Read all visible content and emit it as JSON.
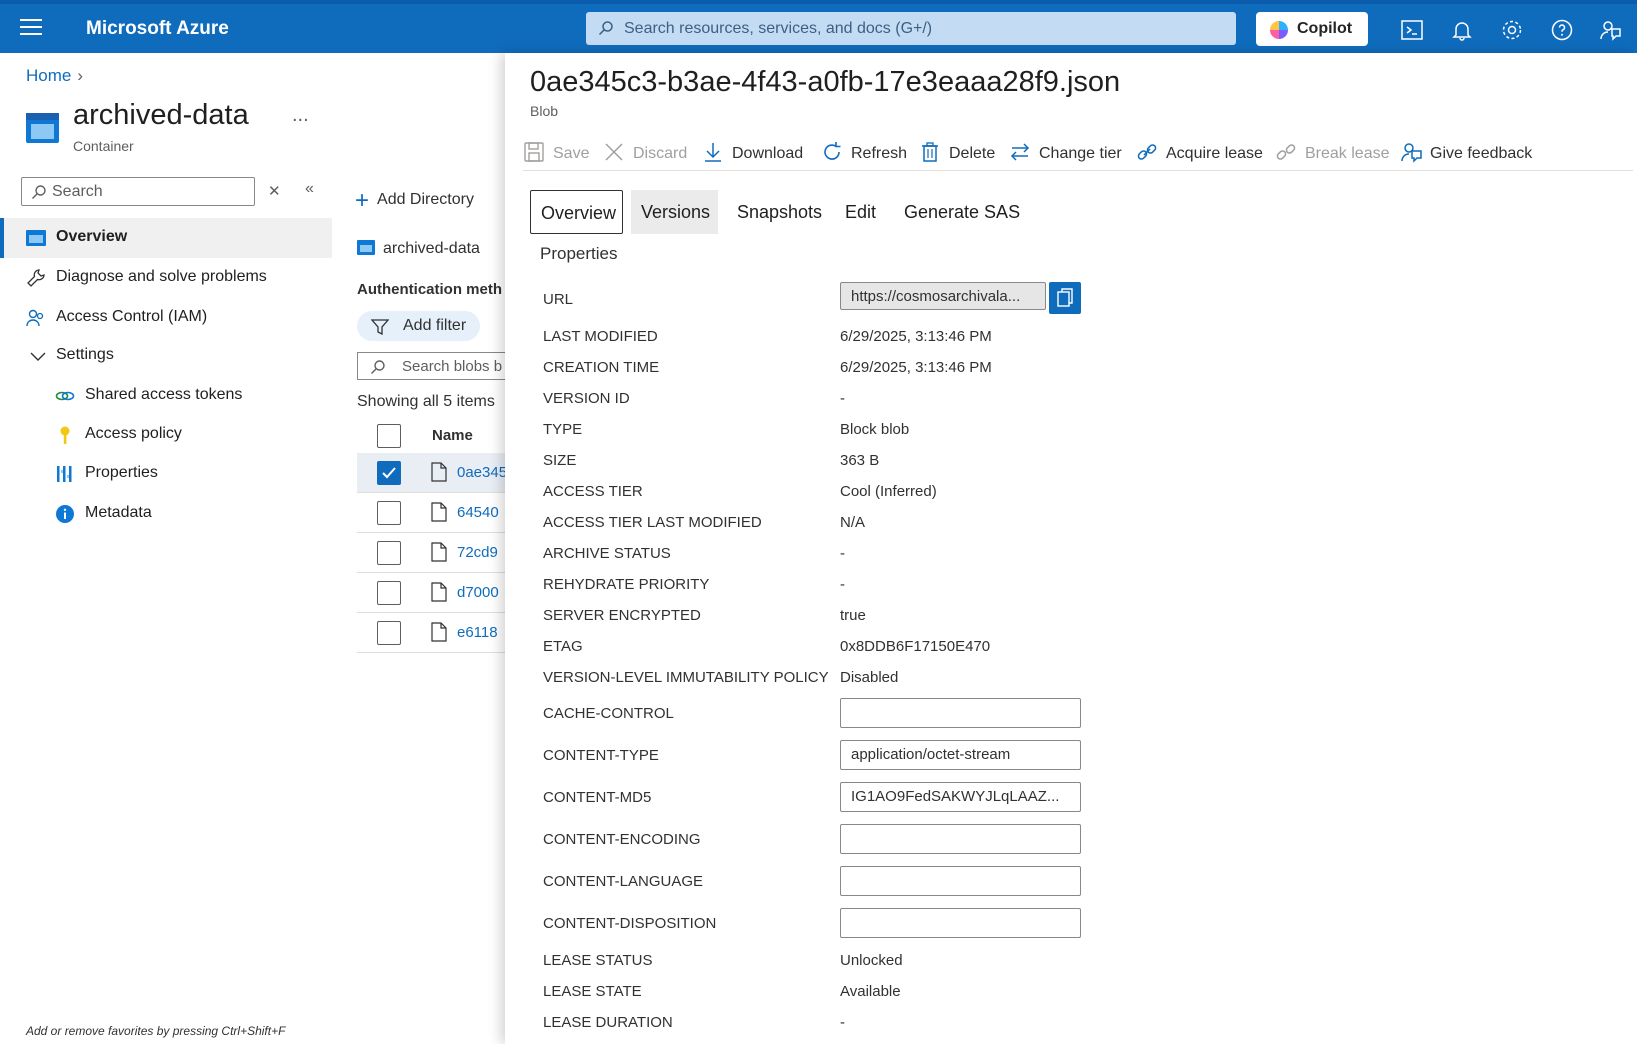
{
  "topbar": {
    "brand": "Microsoft Azure",
    "search_placeholder": "Search resources, services, and docs (G+/)",
    "copilot_label": "Copilot",
    "accent": "#0f6cbd"
  },
  "breadcrumb": {
    "home": "Home"
  },
  "resource": {
    "title": "archived-data",
    "subtitle": "Container",
    "more": "..."
  },
  "leftnav": {
    "search_placeholder": "Search",
    "items": [
      {
        "label": "Overview",
        "icon": "container-icon"
      },
      {
        "label": "Diagnose and solve problems",
        "icon": "wrench-icon"
      },
      {
        "label": "Access Control (IAM)",
        "icon": "people-icon"
      },
      {
        "label": "Settings",
        "icon": "chevron-down-icon"
      },
      {
        "label": "Shared access tokens",
        "icon": "link-icon"
      },
      {
        "label": "Access policy",
        "icon": "key-icon"
      },
      {
        "label": "Properties",
        "icon": "bars-icon"
      },
      {
        "label": "Metadata",
        "icon": "info-icon"
      }
    ],
    "footer_hint": "Add or remove favorites by pressing Ctrl+Shift+F"
  },
  "list": {
    "add_directory": "Add Directory",
    "path": "archived-data",
    "auth_method": "Authentication meth",
    "add_filter": "Add filter",
    "search_placeholder": "Search blobs b",
    "showing": "Showing all 5 items",
    "col_name": "Name",
    "rows": [
      {
        "name": "0ae345",
        "selected": true
      },
      {
        "name": "64540",
        "selected": false
      },
      {
        "name": "72cd9",
        "selected": false
      },
      {
        "name": "d7000",
        "selected": false
      },
      {
        "name": "e6118",
        "selected": false
      }
    ]
  },
  "panel": {
    "title": "0ae345c3-b3ae-4f43-a0fb-17e3eaaa28f9.json",
    "subtitle": "Blob",
    "commands": [
      {
        "label": "Save",
        "icon": "save-icon",
        "disabled": true
      },
      {
        "label": "Discard",
        "icon": "close-icon",
        "disabled": true
      },
      {
        "label": "Download",
        "icon": "download-icon",
        "disabled": false
      },
      {
        "label": "Refresh",
        "icon": "refresh-icon",
        "disabled": false
      },
      {
        "label": "Delete",
        "icon": "trash-icon",
        "disabled": false
      },
      {
        "label": "Change tier",
        "icon": "swap-icon",
        "disabled": false
      },
      {
        "label": "Acquire lease",
        "icon": "link-icon",
        "disabled": false
      },
      {
        "label": "Break lease",
        "icon": "broken-link-icon",
        "disabled": true
      },
      {
        "label": "Give feedback",
        "icon": "feedback-icon",
        "disabled": false
      }
    ],
    "tabs": [
      "Overview",
      "Versions",
      "Snapshots",
      "Edit",
      "Generate SAS"
    ],
    "properties_heading": "Properties",
    "url_label": "URL",
    "url_value": "https://cosmosarchivala...",
    "properties": [
      {
        "key": "LAST MODIFIED",
        "value": "6/29/2025, 3:13:46 PM"
      },
      {
        "key": "CREATION TIME",
        "value": "6/29/2025, 3:13:46 PM"
      },
      {
        "key": "VERSION ID",
        "value": "-"
      },
      {
        "key": "TYPE",
        "value": "Block blob"
      },
      {
        "key": "SIZE",
        "value": "363 B"
      },
      {
        "key": "ACCESS TIER",
        "value": "Cool (Inferred)"
      },
      {
        "key": "ACCESS TIER LAST MODIFIED",
        "value": "N/A"
      },
      {
        "key": "ARCHIVE STATUS",
        "value": "-"
      },
      {
        "key": "REHYDRATE PRIORITY",
        "value": "-"
      },
      {
        "key": "SERVER ENCRYPTED",
        "value": "true"
      },
      {
        "key": "ETAG",
        "value": "0x8DDB6F17150E470"
      },
      {
        "key": "VERSION-LEVEL IMMUTABILITY POLICY",
        "value": "Disabled"
      }
    ],
    "editable": [
      {
        "key": "CACHE-CONTROL",
        "value": ""
      },
      {
        "key": "CONTENT-TYPE",
        "value": "application/octet-stream"
      },
      {
        "key": "CONTENT-MD5",
        "value": "IG1AO9FedSAKWYJLqLAAZ..."
      },
      {
        "key": "CONTENT-ENCODING",
        "value": ""
      },
      {
        "key": "CONTENT-LANGUAGE",
        "value": ""
      },
      {
        "key": "CONTENT-DISPOSITION",
        "value": ""
      }
    ],
    "lease": [
      {
        "key": "LEASE STATUS",
        "value": "Unlocked"
      },
      {
        "key": "LEASE STATE",
        "value": "Available"
      },
      {
        "key": "LEASE DURATION",
        "value": "-"
      }
    ]
  }
}
